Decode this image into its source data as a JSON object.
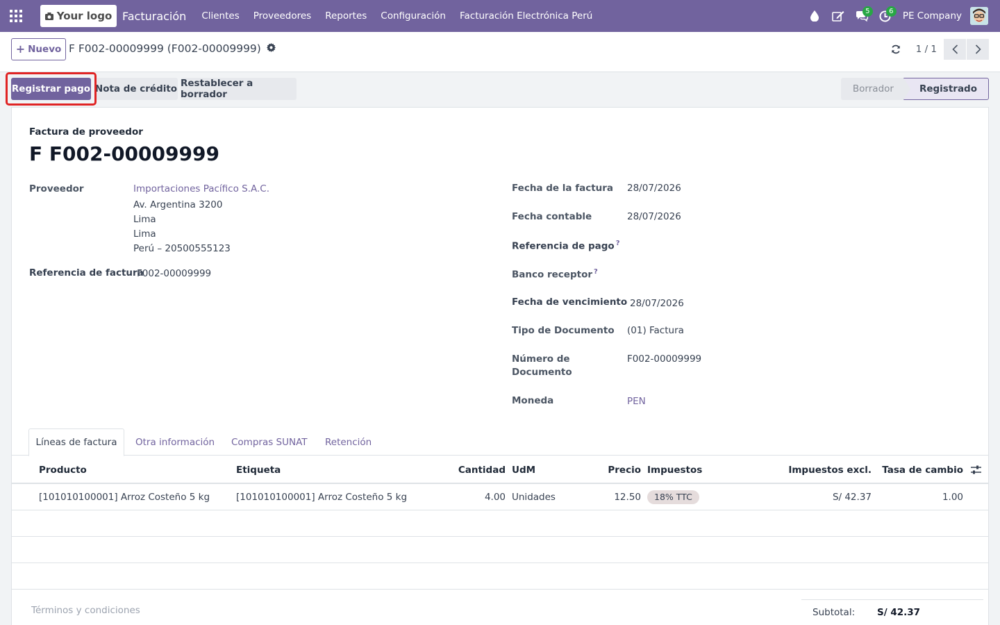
{
  "navbar": {
    "logo_text": "Your logo",
    "app_name": "Facturación",
    "menu": [
      "Clientes",
      "Proveedores",
      "Reportes",
      "Configuración",
      "Facturación Electrónica Perú"
    ],
    "messages_badge": "5",
    "activities_badge": "6",
    "company": "PE Company",
    "brand_color": "#71639e"
  },
  "control_panel": {
    "new_label": "Nuevo",
    "breadcrumb": "F F002-00009999 (F002-00009999)",
    "pager": "1 / 1"
  },
  "statusbar": {
    "register_payment": "Registrar pago",
    "credit_note": "Nota de crédito",
    "reset_draft": "Restablecer a borrador",
    "stages": [
      "Borrador",
      "Registrado"
    ],
    "active_stage": "Registrado"
  },
  "form": {
    "doc_type": "Factura de proveedor",
    "name": "F F002-00009999",
    "left": {
      "vendor_label": "Proveedor",
      "vendor_name": "Importaciones Pacífico S.A.C.",
      "address": [
        "Av. Argentina 3200",
        "Lima",
        "Lima",
        "Perú – 20500555123"
      ],
      "ref_label": "Referencia de factura",
      "ref_value": "F002-00009999"
    },
    "right": {
      "invoice_date_label": "Fecha de la factura",
      "invoice_date": "28/07/2026",
      "accounting_date_label": "Fecha contable",
      "accounting_date": "28/07/2026",
      "payment_ref_label": "Referencia de pago",
      "bank_label": "Banco receptor",
      "due_date_label": "Fecha de vencimiento",
      "due_date": "28/07/2026",
      "doc_kind_label": "Tipo de Documento",
      "doc_kind": "(01) Factura",
      "doc_number_label_1": "Número de",
      "doc_number_label_2": "Documento",
      "doc_number": "F002-00009999",
      "currency_label": "Moneda",
      "currency": "PEN"
    }
  },
  "tabs": [
    "Líneas de factura",
    "Otra información",
    "Compras SUNAT",
    "Retención"
  ],
  "lines": {
    "columns": [
      "Producto",
      "Etiqueta",
      "Cantidad",
      "UdM",
      "Precio",
      "Impuestos",
      "Impuestos excl.",
      "Tasa de cambio"
    ],
    "rows": [
      {
        "product": "[101010100001] Arroz Costeño 5 kg",
        "label": "[101010100001] Arroz Costeño 5 kg",
        "qty": "4.00",
        "uom": "Unidades",
        "price": "12.50",
        "tax": "18% TTC",
        "subtotal": "S/ 42.37",
        "rate": "1.00"
      }
    ]
  },
  "footer": {
    "terms_placeholder": "Términos y condiciones",
    "subtotal_label": "Subtotal:",
    "subtotal_value": "S/ 42.37"
  }
}
